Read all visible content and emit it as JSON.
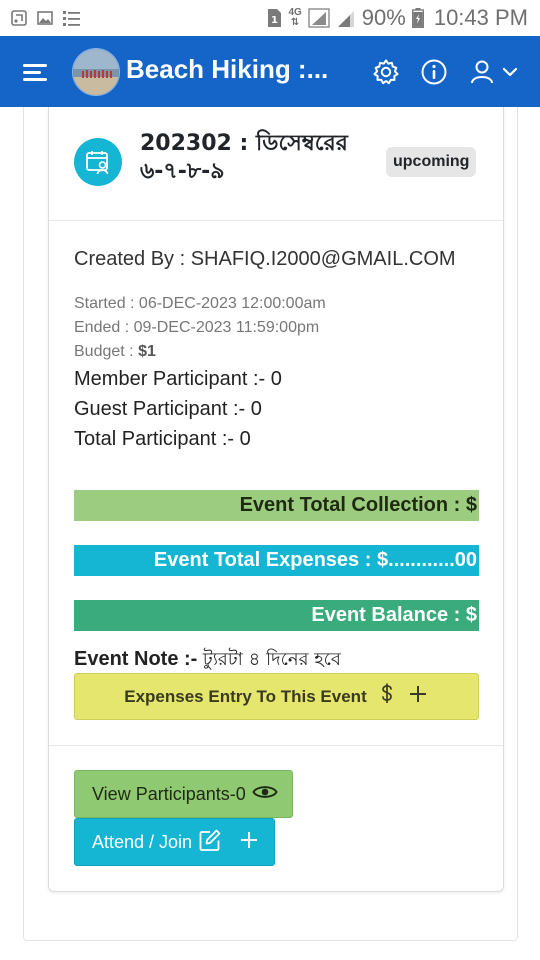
{
  "status_bar": {
    "network": "4G",
    "battery": "90%",
    "time": "10:43 PM",
    "left_icons": [
      "screenshot-icon",
      "gallery-icon",
      "list-icon"
    ]
  },
  "app_bar": {
    "title": "Beach Hiking :...",
    "background": "#1565c8",
    "icons": [
      "menu-icon",
      "settings-icon",
      "info-icon",
      "user-icon",
      "chevron-down-icon"
    ]
  },
  "event": {
    "title": "202302 : ডিসেম্বরের ৬-৭-৮-৯",
    "status": "upcoming",
    "created_by": "Created By : SHAFIQ.I2000@GMAIL.COM",
    "started": "Started : 06-DEC-2023 12:00:00am",
    "ended": "Ended : 09-DEC-2023 11:59:00pm",
    "budget_label": "Budget :",
    "budget_value": "$1",
    "member_participant": "Member Participant :- 0",
    "guest_participant": "Guest Participant :- 0",
    "total_participant": "Total Participant :- 0",
    "total_collection": "Event Total Collection : $",
    "total_expenses": "Event Total Expenses : $............00",
    "balance": "Event Balance : $",
    "note_label": "Event Note :-",
    "note_text": "ট্যুরটা ৪ দিনের হবে"
  },
  "actions": {
    "expense_entry": "Expenses Entry To This Event",
    "view_participants": "View Participants-0",
    "attend_join": "Attend / Join"
  },
  "colors": {
    "accent_blue": "#1565c8",
    "cyan": "#14b6d4",
    "green_light": "#9ccc7f",
    "green_dark": "#3aab7c",
    "yellow": "#e5e66e"
  }
}
